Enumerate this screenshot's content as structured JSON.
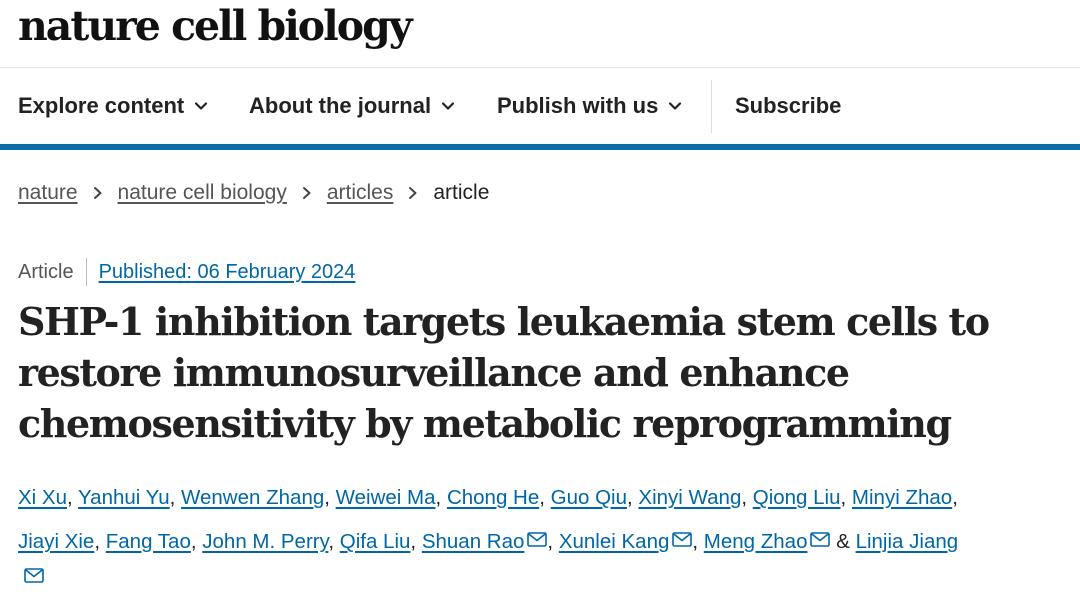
{
  "header": {
    "brand": "nature cell biology"
  },
  "nav": {
    "items": [
      {
        "label": "Explore content",
        "has_dropdown": true
      },
      {
        "label": "About the journal",
        "has_dropdown": true
      },
      {
        "label": "Publish with us",
        "has_dropdown": true
      },
      {
        "label": "Subscribe",
        "has_dropdown": false
      }
    ]
  },
  "breadcrumb": [
    "nature",
    "nature cell biology",
    "articles",
    "article"
  ],
  "article": {
    "type": "Article",
    "published": "Published: 06 February 2024",
    "title": "SHP-1 inhibition targets leukaemia stem cells to restore immunosurveillance and enhance chemosensitivity by metabolic reprogramming"
  },
  "authors": {
    "list": [
      "Xi Xu",
      "Yanhui Yu",
      "Wenwen Zhang",
      "Weiwei Ma",
      "Chong He",
      "Guo Qiu",
      "Xinyi Wang",
      "Qiong Liu",
      "Minyi Zhao",
      "Jiayi Xie",
      "Fang Tao",
      "John M. Perry",
      "Qifa Liu",
      "Shuan Rao",
      "Xunlei Kang",
      "Meng Zhao",
      "Linjia Jiang"
    ],
    "separator": ",",
    "ampersand": "&"
  },
  "colors": {
    "accent_bar": "#0b6ea7",
    "link": "#0067a6",
    "text": "#222222"
  },
  "icons": {
    "dropdown": "chevron-down-icon",
    "breadcrumb": "chevron-right-icon",
    "mail": "mail-icon"
  }
}
